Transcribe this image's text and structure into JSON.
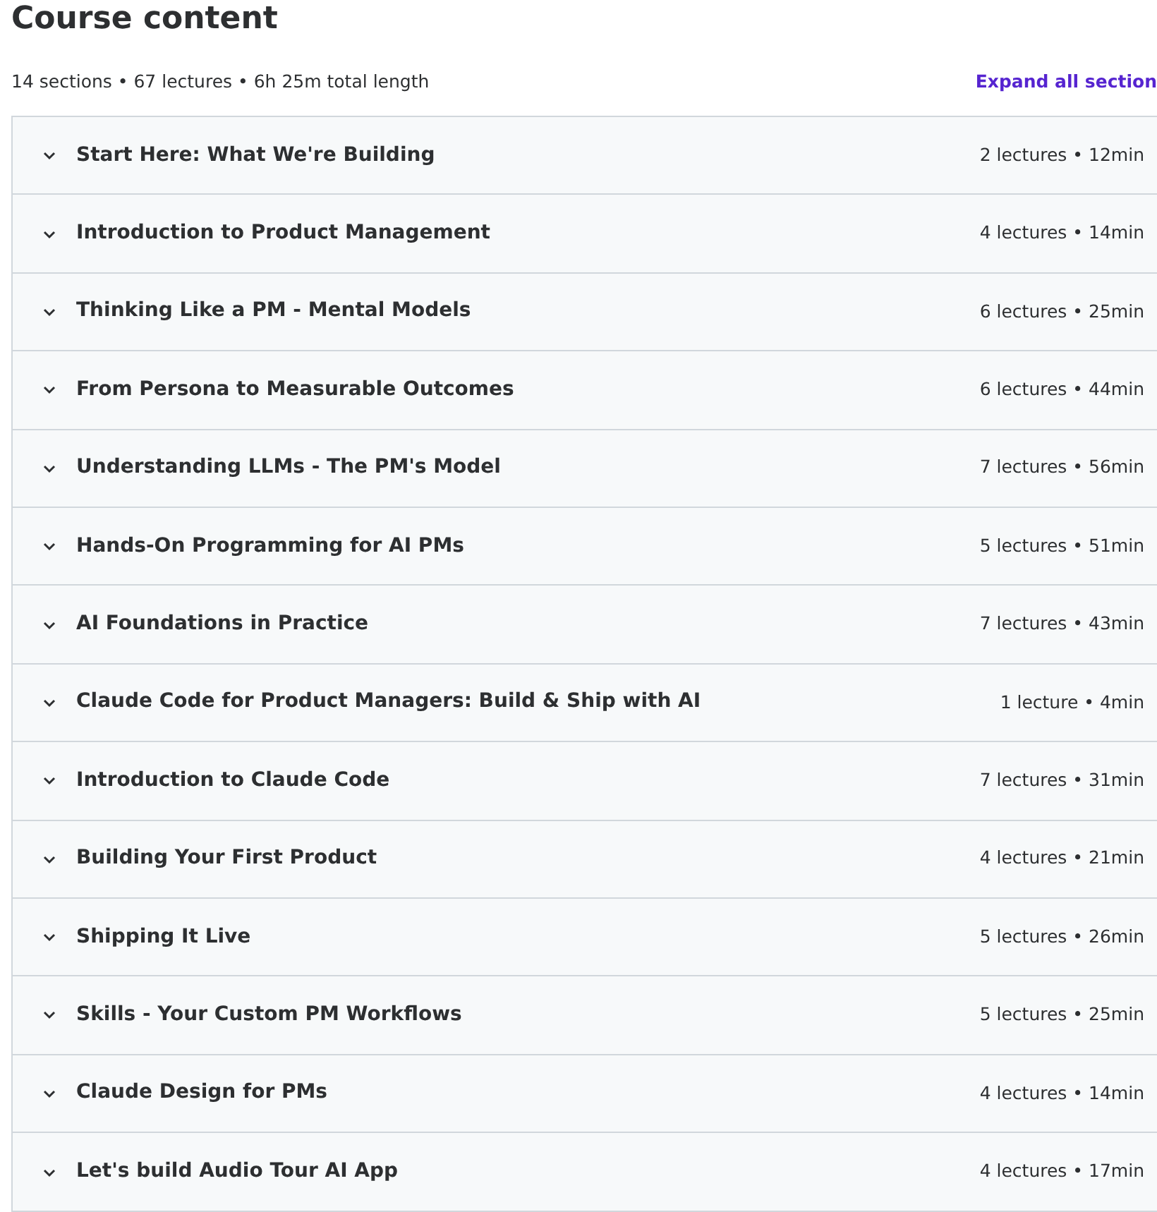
{
  "title": "Course content",
  "summary": "14 sections • 67 lectures • 6h 25m total length",
  "expand_link": "Expand all section",
  "sections": [
    {
      "title": "Start Here: What We're Building",
      "meta": "2 lectures • 12min",
      "expanded": false
    },
    {
      "title": "Introduction to Product Management",
      "meta": "4 lectures • 14min",
      "expanded": false
    },
    {
      "title": "Thinking Like a PM - Mental Models",
      "meta": "6 lectures • 25min",
      "expanded": false
    },
    {
      "title": "From Persona to Measurable Outcomes",
      "meta": "6 lectures • 44min",
      "expanded": false
    },
    {
      "title": "Understanding LLMs - The PM's Model",
      "meta": "7 lectures • 56min",
      "expanded": false
    },
    {
      "title": "Hands-On Programming for AI PMs",
      "meta": "5 lectures • 51min",
      "expanded": false
    },
    {
      "title": "AI Foundations in Practice",
      "meta": "7 lectures • 43min",
      "expanded": false
    },
    {
      "title": "Claude Code for Product Managers: Build & Ship with AI",
      "meta": "1 lecture • 4min",
      "expanded": false
    },
    {
      "title": "Introduction to Claude Code",
      "meta": "7 lectures • 31min",
      "expanded": false
    },
    {
      "title": "Building Your First Product",
      "meta": "4 lectures • 21min",
      "expanded": false
    },
    {
      "title": "Shipping It Live",
      "meta": "5 lectures • 26min",
      "expanded": false
    },
    {
      "title": "Skills - Your Custom PM Workflows",
      "meta": "5 lectures • 25min",
      "expanded": false
    },
    {
      "title": "Claude Design for PMs",
      "meta": "4 lectures • 14min",
      "expanded": false
    },
    {
      "title": "Let's build Audio Tour AI App",
      "meta": "4 lectures • 17min",
      "expanded": false
    }
  ]
}
